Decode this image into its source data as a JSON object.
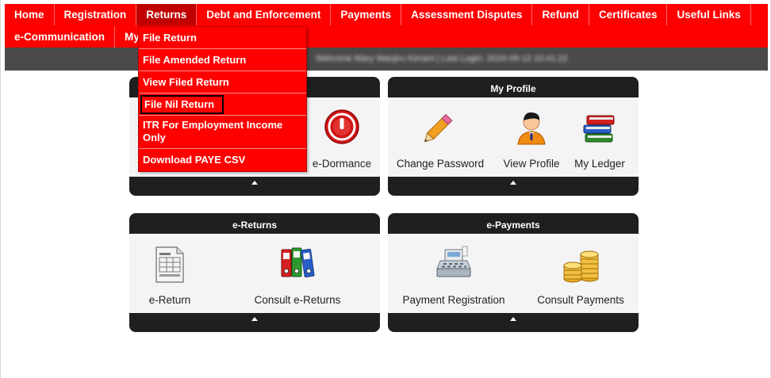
{
  "nav": {
    "row1": [
      "Home",
      "Registration",
      "Returns",
      "Debt and Enforcement",
      "Payments",
      "Assessment Disputes",
      "Refund",
      "Certificates",
      "Useful Links"
    ],
    "row2": [
      "e-Communication",
      "My"
    ]
  },
  "userbar": {
    "text": "Welcome Mary Wanjiru Kimani | Last Login: 2024-09-12 10:41:22"
  },
  "returns_menu": {
    "items": [
      "File Return",
      "File Amended Return",
      "View Filed Return",
      "File Nil Return",
      "ITR For Employment Income Only",
      "Download PAYE CSV"
    ],
    "highlighted": "File Nil Return"
  },
  "panels": {
    "registration": {
      "title": "",
      "tiles": [
        "e-Dormance"
      ]
    },
    "profile": {
      "title": "My Profile",
      "tiles": [
        "Change Password",
        "View Profile",
        "My Ledger"
      ]
    },
    "returns": {
      "title": "e-Returns",
      "tiles": [
        "e-Return",
        "Consult e-Returns"
      ]
    },
    "payments": {
      "title": "e-Payments",
      "tiles": [
        "Payment Registration",
        "Consult Payments"
      ]
    }
  },
  "colors": {
    "nav_red": "#ff0000",
    "active_red": "#c00000",
    "panel_dark": "#1f1f1f",
    "bar_grey": "#4a4a4a"
  },
  "icons": {
    "dormance": "power-icon",
    "change_password": "pencil-icon",
    "view_profile": "user-icon",
    "my_ledger": "books-icon",
    "e_return": "document-icon",
    "consult_returns": "binders-icon",
    "payment_registration": "cash-register-icon",
    "consult_payments": "coins-icon"
  }
}
